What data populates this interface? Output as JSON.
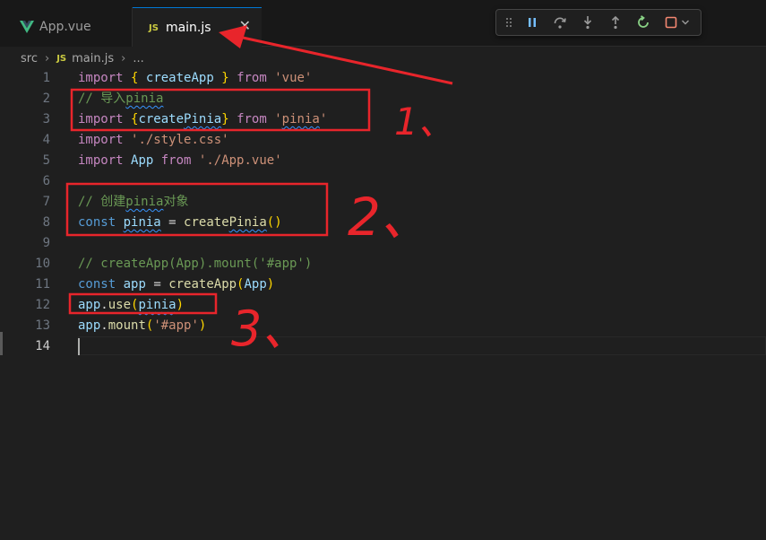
{
  "tabs": [
    {
      "label": "App.vue",
      "icon": "vue-icon",
      "active": false
    },
    {
      "label": "main.js",
      "icon": "js-icon",
      "active": true
    }
  ],
  "tab_icon_text": "JS",
  "close_glyph": "✕",
  "debug_toolbar": [
    "drag-grip-icon",
    "pause-icon",
    "step-over-icon",
    "step-into-icon",
    "step-out-icon",
    "restart-icon",
    "stop-icon",
    "chevron-down-icon"
  ],
  "breadcrumb": {
    "folder": "src",
    "file": "main.js",
    "sep": "›",
    "more": "..."
  },
  "lines": [
    {
      "n": "1",
      "tokens": [
        [
          "kw2",
          "import"
        ],
        [
          "plain",
          " "
        ],
        [
          "brace2",
          "{"
        ],
        [
          "plain",
          " "
        ],
        [
          "var",
          "createApp"
        ],
        [
          "plain",
          " "
        ],
        [
          "brace2",
          "}"
        ],
        [
          "plain",
          " "
        ],
        [
          "kw2",
          "from"
        ],
        [
          "plain",
          " "
        ],
        [
          "str",
          "'vue'"
        ]
      ]
    },
    {
      "n": "2",
      "tokens": [
        [
          "cm",
          "// 导入"
        ],
        [
          "cm squig",
          "pinia"
        ]
      ]
    },
    {
      "n": "3",
      "tokens": [
        [
          "kw2",
          "import"
        ],
        [
          "plain",
          " "
        ],
        [
          "brace2",
          "{"
        ],
        [
          "var",
          "create"
        ],
        [
          "var squig",
          "Pinia"
        ],
        [
          "brace2",
          "}"
        ],
        [
          "plain",
          " "
        ],
        [
          "kw2",
          "from"
        ],
        [
          "plain",
          " "
        ],
        [
          "str",
          "'"
        ],
        [
          "str squig",
          "pinia"
        ],
        [
          "str",
          "'"
        ]
      ]
    },
    {
      "n": "4",
      "tokens": [
        [
          "kw2",
          "import"
        ],
        [
          "plain",
          " "
        ],
        [
          "str",
          "'./style.css'"
        ]
      ]
    },
    {
      "n": "5",
      "tokens": [
        [
          "kw2",
          "import"
        ],
        [
          "plain",
          " "
        ],
        [
          "var",
          "App"
        ],
        [
          "plain",
          " "
        ],
        [
          "kw2",
          "from"
        ],
        [
          "plain",
          " "
        ],
        [
          "str",
          "'./App.vue'"
        ]
      ]
    },
    {
      "n": "6",
      "tokens": []
    },
    {
      "n": "7",
      "tokens": [
        [
          "cm",
          "// 创建"
        ],
        [
          "cm squig",
          "pinia"
        ],
        [
          "cm",
          "对象"
        ]
      ]
    },
    {
      "n": "8",
      "tokens": [
        [
          "kw",
          "const"
        ],
        [
          "plain",
          " "
        ],
        [
          "var squig",
          "pinia"
        ],
        [
          "plain",
          " = "
        ],
        [
          "fn",
          "create"
        ],
        [
          "fn squig",
          "Pinia"
        ],
        [
          "brace2",
          "()"
        ]
      ]
    },
    {
      "n": "9",
      "tokens": []
    },
    {
      "n": "10",
      "tokens": [
        [
          "cm",
          "// createApp(App).mount('#app')"
        ]
      ]
    },
    {
      "n": "11",
      "tokens": [
        [
          "kw",
          "const"
        ],
        [
          "plain",
          " "
        ],
        [
          "var",
          "app"
        ],
        [
          "plain",
          " = "
        ],
        [
          "fn",
          "createApp"
        ],
        [
          "brace2",
          "("
        ],
        [
          "var",
          "App"
        ],
        [
          "brace2",
          ")"
        ]
      ]
    },
    {
      "n": "12",
      "tokens": [
        [
          "var",
          "app"
        ],
        [
          "plain",
          "."
        ],
        [
          "fn",
          "use"
        ],
        [
          "brace2",
          "("
        ],
        [
          "var squig",
          "pinia"
        ],
        [
          "brace2",
          ")"
        ]
      ]
    },
    {
      "n": "13",
      "tokens": [
        [
          "var",
          "app"
        ],
        [
          "plain",
          "."
        ],
        [
          "fn",
          "mount"
        ],
        [
          "brace2",
          "("
        ],
        [
          "str",
          "'#app'"
        ],
        [
          "brace2",
          ")"
        ]
      ]
    },
    {
      "n": "14",
      "tokens": [],
      "current": true
    }
  ],
  "annotations": {
    "labels": [
      "1、",
      "2、",
      "3、"
    ],
    "color": "#e8252b"
  },
  "colors": {
    "background": "#1f1f1f",
    "active_tab_border": "#0078d4",
    "keyword": "#c586c0",
    "string": "#ce9178",
    "comment": "#6a9955",
    "variable": "#9cdcfe"
  }
}
